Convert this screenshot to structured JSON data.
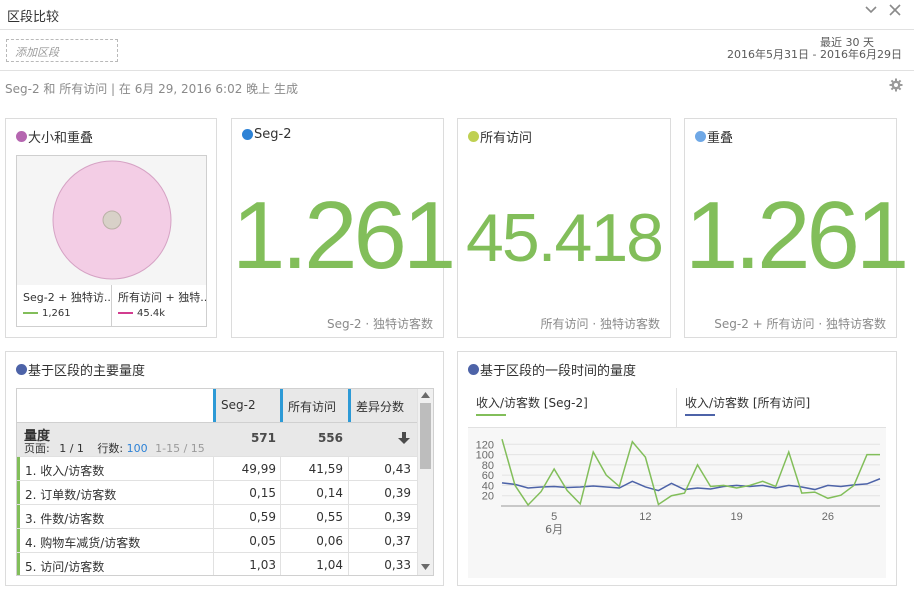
{
  "window": {
    "title": "区段比较",
    "collapse_icon": "chevron-down-icon",
    "close_icon": "close-icon"
  },
  "toolbar": {
    "segment_placeholder": "添加区段",
    "date_preset": "最近 30 天",
    "date_range": "2016年5月31日 - 2016年6月29日"
  },
  "info_line": "Seg-2 和 所有访问 | 在 6月 29, 2016 6:02 晚上 生成",
  "colors": {
    "seg2": "#82be5a",
    "all_visits_line": "#4d63a8",
    "accent": "#2d9ad6",
    "overlap": "#e8b8d8",
    "magenta": "#d23c8f"
  },
  "panels": {
    "venn": {
      "title": "大小和重叠",
      "legend": [
        {
          "label": "Seg-2 + 独特访...",
          "value": "1,261"
        },
        {
          "label": "所有访问 + 独特...",
          "value": "45.4k"
        }
      ]
    },
    "seg2": {
      "title": "Seg-2",
      "value": "1.261",
      "subtitle": "Seg-2 · 独特访客数"
    },
    "all": {
      "title": "所有访问",
      "value": "45.418",
      "subtitle": "所有访问 · 独特访客数"
    },
    "overlap": {
      "title": "重叠",
      "value": "1.261",
      "subtitle": "Seg-2 + 所有访问 · 独特访客数"
    },
    "table": {
      "title": "基于区段的主要量度",
      "columns": [
        "Seg-2",
        "所有访问",
        "差异分数"
      ],
      "summary": {
        "label": "量度",
        "page_label": "页面:",
        "page": "1 / 1",
        "rows_label": "行数:",
        "rows": "100",
        "range": "1-15 / 15",
        "seg2_total": "571",
        "all_total": "556",
        "sort_icon": "arrow-down-icon"
      },
      "rows": [
        {
          "name": "1. 收入/访客数",
          "seg2": "49,99",
          "all": "41,59",
          "diff": "0,43"
        },
        {
          "name": "2. 订单数/访客数",
          "seg2": "0,15",
          "all": "0,14",
          "diff": "0,39"
        },
        {
          "name": "3. 件数/访客数",
          "seg2": "0,59",
          "all": "0,55",
          "diff": "0,39"
        },
        {
          "name": "4. 购物车减货/访客数",
          "seg2": "0,05",
          "all": "0,06",
          "diff": "0,37"
        },
        {
          "name": "5. 访问/访客数",
          "seg2": "1,03",
          "all": "1,04",
          "diff": "0,33"
        }
      ]
    },
    "trend": {
      "title": "基于区段的一段时间的量度",
      "legend": [
        "收入/访客数 [Seg-2]",
        "收入/访客数 [所有访问]"
      ]
    }
  },
  "chart_data": {
    "type": "line",
    "x": [
      1,
      2,
      3,
      4,
      5,
      6,
      7,
      8,
      9,
      10,
      11,
      12,
      13,
      14,
      15,
      16,
      17,
      18,
      19,
      20,
      21,
      22,
      23,
      24,
      25,
      26,
      27,
      28,
      29,
      30
    ],
    "x_ticks": [
      "5",
      "12",
      "19",
      "26"
    ],
    "x_tick_values": [
      5,
      12,
      19,
      26
    ],
    "x_month_label": "6月",
    "y_ticks": [
      20,
      40,
      60,
      80,
      100,
      120
    ],
    "ylim": [
      0,
      140
    ],
    "series": [
      {
        "name": "收入/访客数 [Seg-2]",
        "color": "#82be5a",
        "values": [
          130,
          40,
          2,
          28,
          72,
          30,
          4,
          105,
          60,
          38,
          125,
          95,
          3,
          20,
          25,
          80,
          38,
          40,
          35,
          40,
          48,
          38,
          105,
          25,
          27,
          15,
          21,
          40,
          100,
          100
        ]
      },
      {
        "name": "收入/访客数 [所有访问]",
        "color": "#4d63a8",
        "values": [
          45,
          42,
          35,
          37,
          38,
          36,
          37,
          39,
          37,
          35,
          48,
          37,
          30,
          44,
          32,
          35,
          33,
          38,
          40,
          38,
          40,
          35,
          40,
          37,
          32,
          40,
          38,
          41,
          43,
          53
        ]
      }
    ]
  }
}
